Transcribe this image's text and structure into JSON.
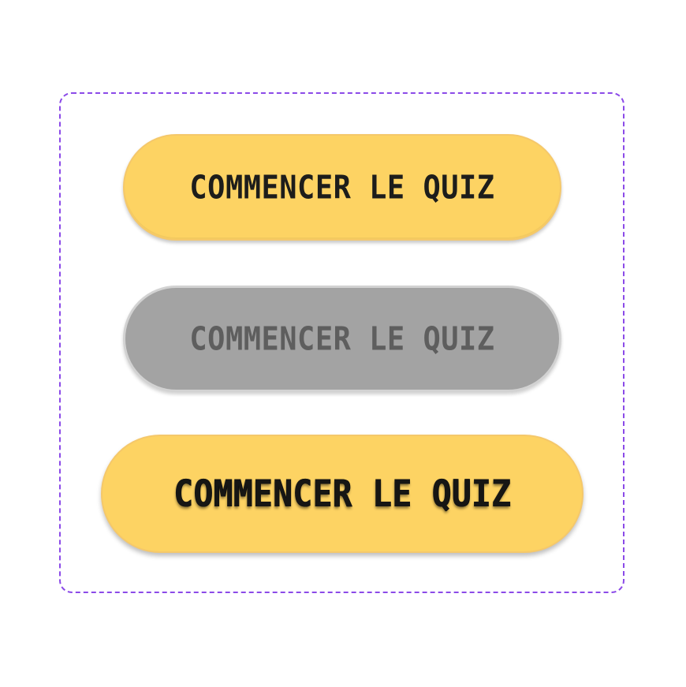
{
  "buttons": {
    "default": {
      "label": "COMMENCER LE QUIZ",
      "state": "default"
    },
    "disabled": {
      "label": "COMMENCER LE QUIZ",
      "state": "disabled"
    },
    "hover": {
      "label": "COMMENCER LE QUIZ",
      "state": "hover"
    }
  },
  "colors": {
    "accent": "#fdd363",
    "disabled": "#a3a3a3",
    "frame_border": "#8b4ae8",
    "text_dark": "#1d1d1b",
    "text_disabled": "#5e5e5e"
  }
}
